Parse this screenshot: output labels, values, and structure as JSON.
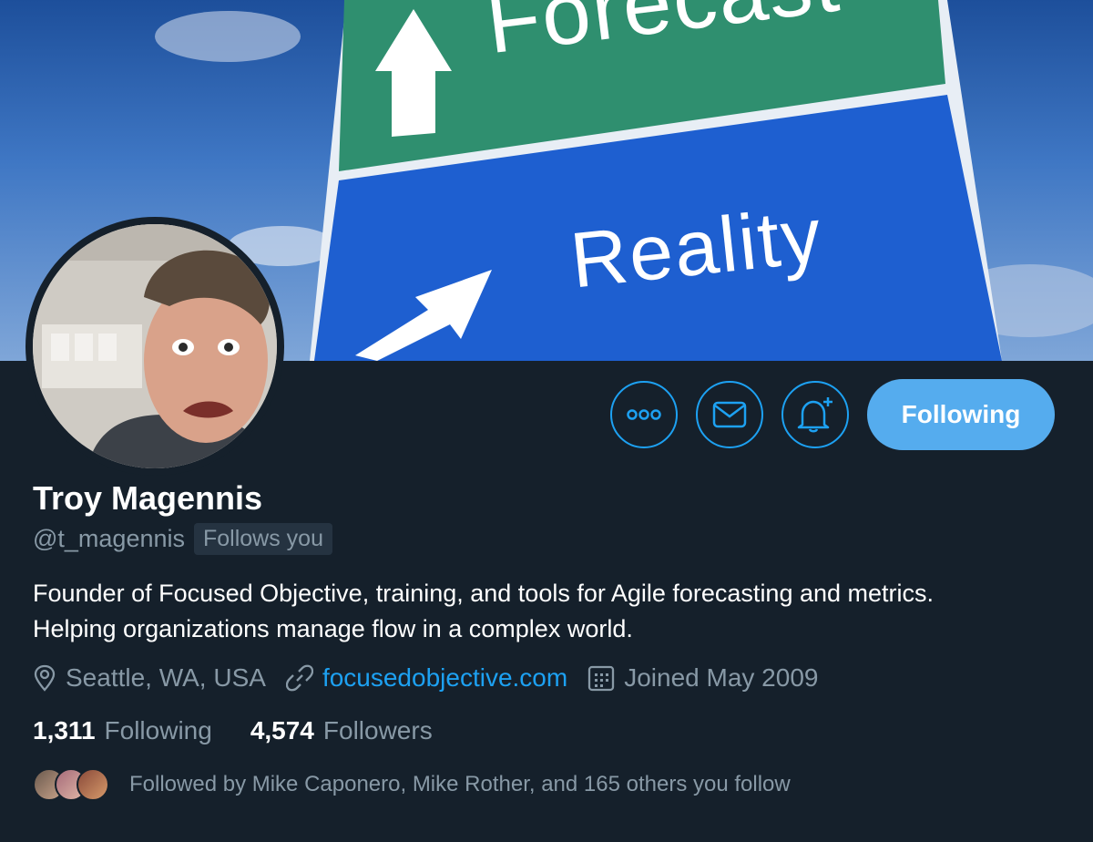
{
  "banner": {
    "sign_top": "Forecast",
    "sign_bottom": "Reality"
  },
  "actions": {
    "more_icon": "more-icon",
    "message_icon": "mail-icon",
    "notify_icon": "bell-plus-icon",
    "follow_label": "Following"
  },
  "profile": {
    "name": "Troy Magennis",
    "handle": "@t_magennis",
    "follows_you": "Follows you",
    "bio_line1": "Founder of Focused Objective, training, and tools for Agile forecasting and metrics.",
    "bio_line2": "Helping organizations manage flow in a complex world.",
    "location": "Seattle, WA, USA",
    "website": "focusedobjective.com",
    "joined": "Joined May 2009"
  },
  "counts": {
    "following_count": "1,311",
    "following_label": "Following",
    "followers_count": "4,574",
    "followers_label": "Followers"
  },
  "followed_by": "Followed by Mike Caponero, Mike Rother, and 165 others you follow",
  "colors": {
    "background": "#15202b",
    "accent": "#1da1f2",
    "follow_button": "#55acee",
    "muted_text": "#8899a6"
  }
}
